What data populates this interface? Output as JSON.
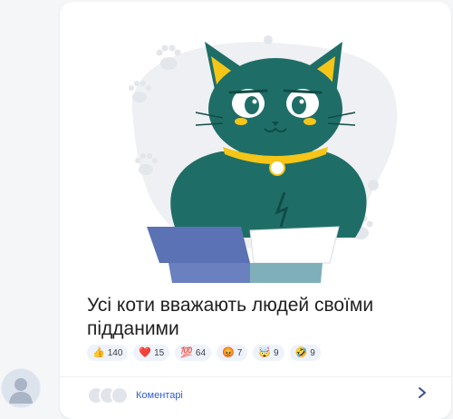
{
  "post": {
    "title": "Усі коти вважають людей своїми підданими"
  },
  "reactions": [
    {
      "icon": "thumbs-up-icon",
      "emoji": "👍",
      "count": "140"
    },
    {
      "icon": "heart-icon",
      "emoji": "❤️",
      "count": "15"
    },
    {
      "icon": "hundred-points-icon",
      "emoji": "💯",
      "count": "64"
    },
    {
      "icon": "angry-face-icon",
      "emoji": "😡",
      "count": "7"
    },
    {
      "icon": "exploding-head-icon",
      "emoji": "🤯",
      "count": "9"
    },
    {
      "icon": "laughing-face-icon",
      "emoji": "🤣",
      "count": "9"
    }
  ],
  "footer": {
    "comments_label": "Коментарі"
  },
  "colors": {
    "accent": "#2f5bd1",
    "cat": "#1e6e67",
    "box": "#6a80bf",
    "collar": "#f5c518",
    "chip_bg": "#eef2fb"
  }
}
